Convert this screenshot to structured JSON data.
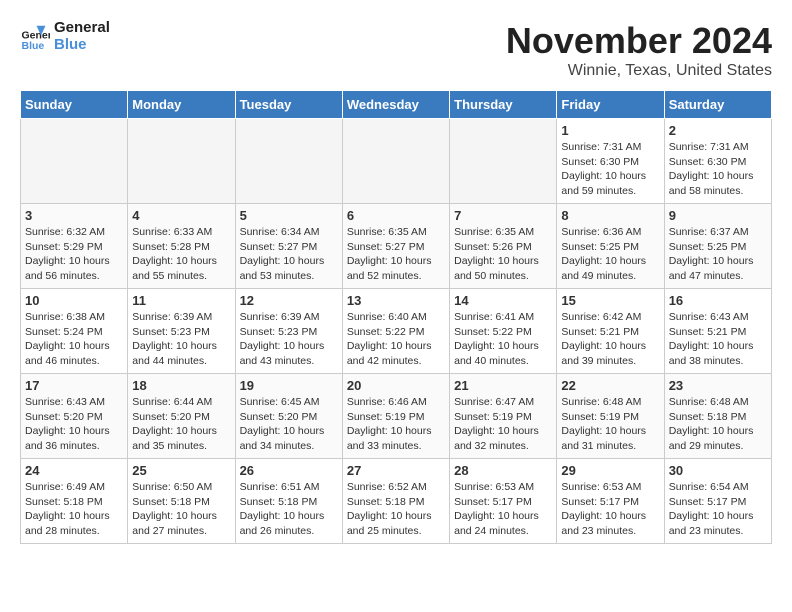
{
  "logo": {
    "line1": "General",
    "line2": "Blue"
  },
  "title": "November 2024",
  "location": "Winnie, Texas, United States",
  "weekdays": [
    "Sunday",
    "Monday",
    "Tuesday",
    "Wednesday",
    "Thursday",
    "Friday",
    "Saturday"
  ],
  "weeks": [
    [
      {
        "day": "",
        "empty": true
      },
      {
        "day": "",
        "empty": true
      },
      {
        "day": "",
        "empty": true
      },
      {
        "day": "",
        "empty": true
      },
      {
        "day": "",
        "empty": true
      },
      {
        "day": "1",
        "sunrise": "Sunrise: 7:31 AM",
        "sunset": "Sunset: 6:30 PM",
        "daylight": "Daylight: 10 hours and 59 minutes."
      },
      {
        "day": "2",
        "sunrise": "Sunrise: 7:31 AM",
        "sunset": "Sunset: 6:30 PM",
        "daylight": "Daylight: 10 hours and 58 minutes."
      }
    ],
    [
      {
        "day": "3",
        "sunrise": "Sunrise: 6:32 AM",
        "sunset": "Sunset: 5:29 PM",
        "daylight": "Daylight: 10 hours and 56 minutes."
      },
      {
        "day": "4",
        "sunrise": "Sunrise: 6:33 AM",
        "sunset": "Sunset: 5:28 PM",
        "daylight": "Daylight: 10 hours and 55 minutes."
      },
      {
        "day": "5",
        "sunrise": "Sunrise: 6:34 AM",
        "sunset": "Sunset: 5:27 PM",
        "daylight": "Daylight: 10 hours and 53 minutes."
      },
      {
        "day": "6",
        "sunrise": "Sunrise: 6:35 AM",
        "sunset": "Sunset: 5:27 PM",
        "daylight": "Daylight: 10 hours and 52 minutes."
      },
      {
        "day": "7",
        "sunrise": "Sunrise: 6:35 AM",
        "sunset": "Sunset: 5:26 PM",
        "daylight": "Daylight: 10 hours and 50 minutes."
      },
      {
        "day": "8",
        "sunrise": "Sunrise: 6:36 AM",
        "sunset": "Sunset: 5:25 PM",
        "daylight": "Daylight: 10 hours and 49 minutes."
      },
      {
        "day": "9",
        "sunrise": "Sunrise: 6:37 AM",
        "sunset": "Sunset: 5:25 PM",
        "daylight": "Daylight: 10 hours and 47 minutes."
      }
    ],
    [
      {
        "day": "10",
        "sunrise": "Sunrise: 6:38 AM",
        "sunset": "Sunset: 5:24 PM",
        "daylight": "Daylight: 10 hours and 46 minutes."
      },
      {
        "day": "11",
        "sunrise": "Sunrise: 6:39 AM",
        "sunset": "Sunset: 5:23 PM",
        "daylight": "Daylight: 10 hours and 44 minutes."
      },
      {
        "day": "12",
        "sunrise": "Sunrise: 6:39 AM",
        "sunset": "Sunset: 5:23 PM",
        "daylight": "Daylight: 10 hours and 43 minutes."
      },
      {
        "day": "13",
        "sunrise": "Sunrise: 6:40 AM",
        "sunset": "Sunset: 5:22 PM",
        "daylight": "Daylight: 10 hours and 42 minutes."
      },
      {
        "day": "14",
        "sunrise": "Sunrise: 6:41 AM",
        "sunset": "Sunset: 5:22 PM",
        "daylight": "Daylight: 10 hours and 40 minutes."
      },
      {
        "day": "15",
        "sunrise": "Sunrise: 6:42 AM",
        "sunset": "Sunset: 5:21 PM",
        "daylight": "Daylight: 10 hours and 39 minutes."
      },
      {
        "day": "16",
        "sunrise": "Sunrise: 6:43 AM",
        "sunset": "Sunset: 5:21 PM",
        "daylight": "Daylight: 10 hours and 38 minutes."
      }
    ],
    [
      {
        "day": "17",
        "sunrise": "Sunrise: 6:43 AM",
        "sunset": "Sunset: 5:20 PM",
        "daylight": "Daylight: 10 hours and 36 minutes."
      },
      {
        "day": "18",
        "sunrise": "Sunrise: 6:44 AM",
        "sunset": "Sunset: 5:20 PM",
        "daylight": "Daylight: 10 hours and 35 minutes."
      },
      {
        "day": "19",
        "sunrise": "Sunrise: 6:45 AM",
        "sunset": "Sunset: 5:20 PM",
        "daylight": "Daylight: 10 hours and 34 minutes."
      },
      {
        "day": "20",
        "sunrise": "Sunrise: 6:46 AM",
        "sunset": "Sunset: 5:19 PM",
        "daylight": "Daylight: 10 hours and 33 minutes."
      },
      {
        "day": "21",
        "sunrise": "Sunrise: 6:47 AM",
        "sunset": "Sunset: 5:19 PM",
        "daylight": "Daylight: 10 hours and 32 minutes."
      },
      {
        "day": "22",
        "sunrise": "Sunrise: 6:48 AM",
        "sunset": "Sunset: 5:19 PM",
        "daylight": "Daylight: 10 hours and 31 minutes."
      },
      {
        "day": "23",
        "sunrise": "Sunrise: 6:48 AM",
        "sunset": "Sunset: 5:18 PM",
        "daylight": "Daylight: 10 hours and 29 minutes."
      }
    ],
    [
      {
        "day": "24",
        "sunrise": "Sunrise: 6:49 AM",
        "sunset": "Sunset: 5:18 PM",
        "daylight": "Daylight: 10 hours and 28 minutes."
      },
      {
        "day": "25",
        "sunrise": "Sunrise: 6:50 AM",
        "sunset": "Sunset: 5:18 PM",
        "daylight": "Daylight: 10 hours and 27 minutes."
      },
      {
        "day": "26",
        "sunrise": "Sunrise: 6:51 AM",
        "sunset": "Sunset: 5:18 PM",
        "daylight": "Daylight: 10 hours and 26 minutes."
      },
      {
        "day": "27",
        "sunrise": "Sunrise: 6:52 AM",
        "sunset": "Sunset: 5:18 PM",
        "daylight": "Daylight: 10 hours and 25 minutes."
      },
      {
        "day": "28",
        "sunrise": "Sunrise: 6:53 AM",
        "sunset": "Sunset: 5:17 PM",
        "daylight": "Daylight: 10 hours and 24 minutes."
      },
      {
        "day": "29",
        "sunrise": "Sunrise: 6:53 AM",
        "sunset": "Sunset: 5:17 PM",
        "daylight": "Daylight: 10 hours and 23 minutes."
      },
      {
        "day": "30",
        "sunrise": "Sunrise: 6:54 AM",
        "sunset": "Sunset: 5:17 PM",
        "daylight": "Daylight: 10 hours and 23 minutes."
      }
    ]
  ]
}
